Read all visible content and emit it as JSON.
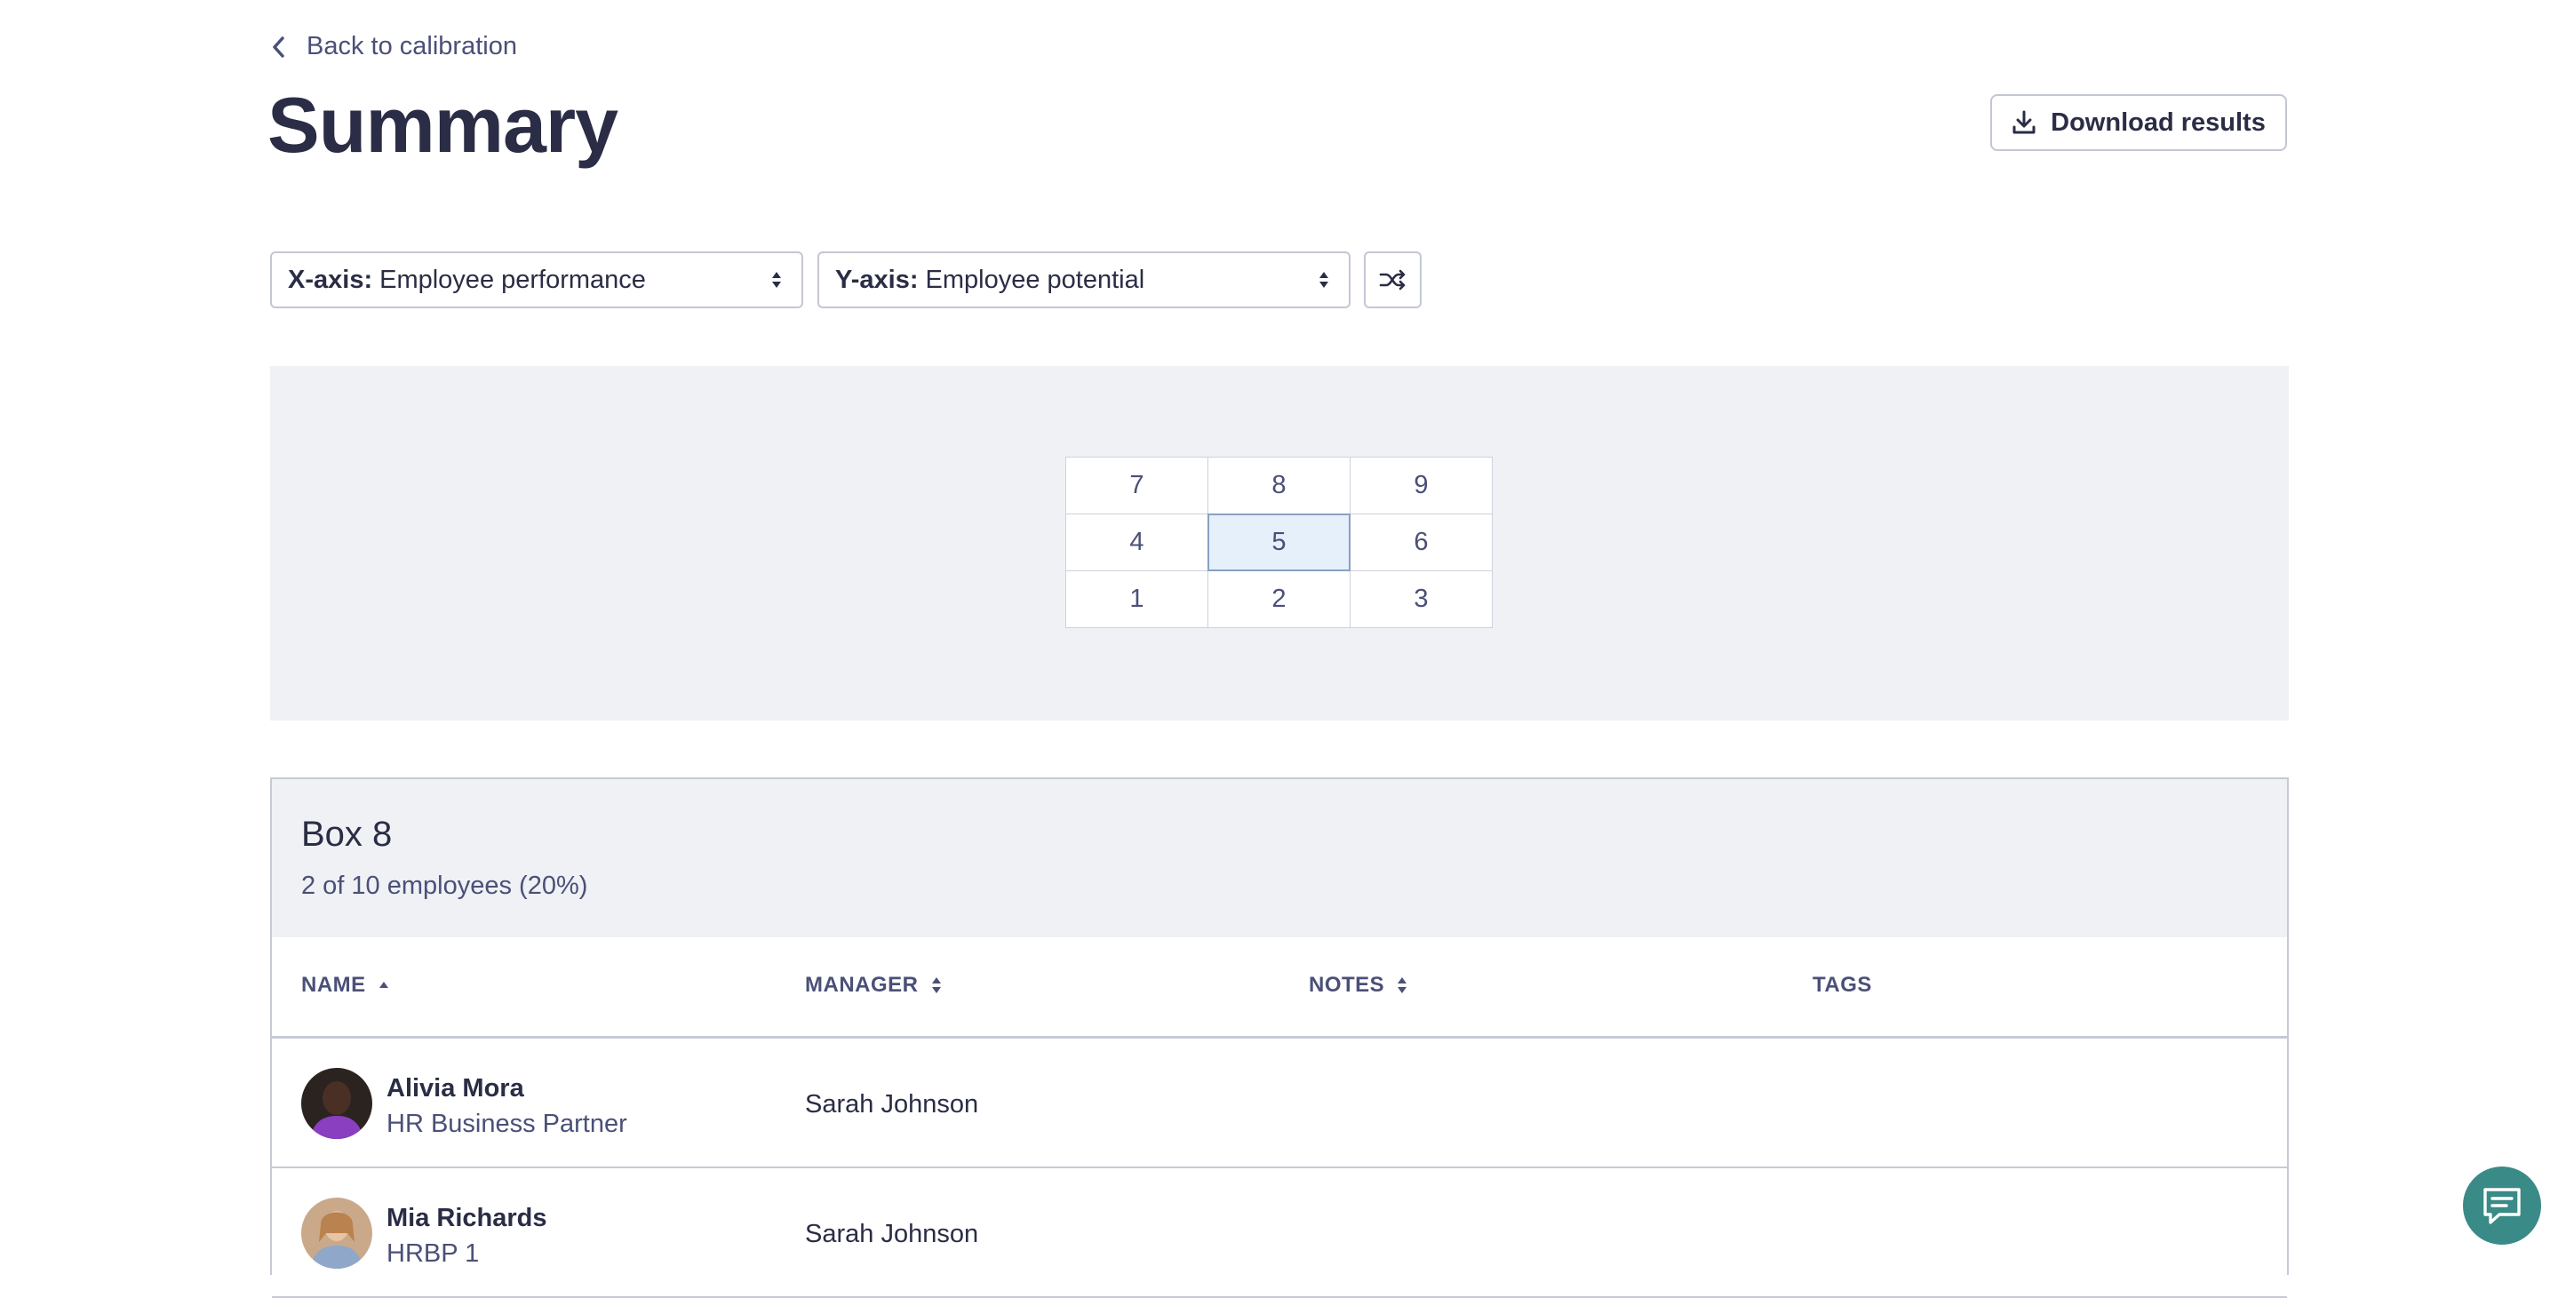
{
  "back_link": "Back to calibration",
  "page_title": "Summary",
  "download_label": "Download results",
  "x_axis": {
    "label": "X-axis:",
    "value": "Employee performance"
  },
  "y_axis": {
    "label": "Y-axis:",
    "value": "Employee potential"
  },
  "grid": {
    "cells": [
      "7",
      "8",
      "9",
      "4",
      "5",
      "6",
      "1",
      "2",
      "3"
    ],
    "selected": "5"
  },
  "box": {
    "title": "Box 8",
    "subtitle": "2 of 10 employees (20%)"
  },
  "table": {
    "headers": {
      "name": "NAME",
      "manager": "MANAGER",
      "notes": "NOTES",
      "tags": "TAGS"
    },
    "rows": [
      {
        "name": "Alivia Mora",
        "role": "HR Business Partner",
        "manager": "Sarah Johnson"
      },
      {
        "name": "Mia Richards",
        "role": "HRBP 1",
        "manager": "Sarah Johnson"
      }
    ]
  },
  "icons": {
    "back": "chevron-left-icon",
    "download": "download-icon",
    "select": "select-caret-icon",
    "shuffle": "shuffle-icon",
    "sort_asc": "sort-ascending-icon",
    "sort": "sort-icon",
    "chat": "chat-icon"
  },
  "colors": {
    "accent": "#3a8a87",
    "panel": "#eff1f5",
    "selected_cell": "#e6f0fb"
  }
}
